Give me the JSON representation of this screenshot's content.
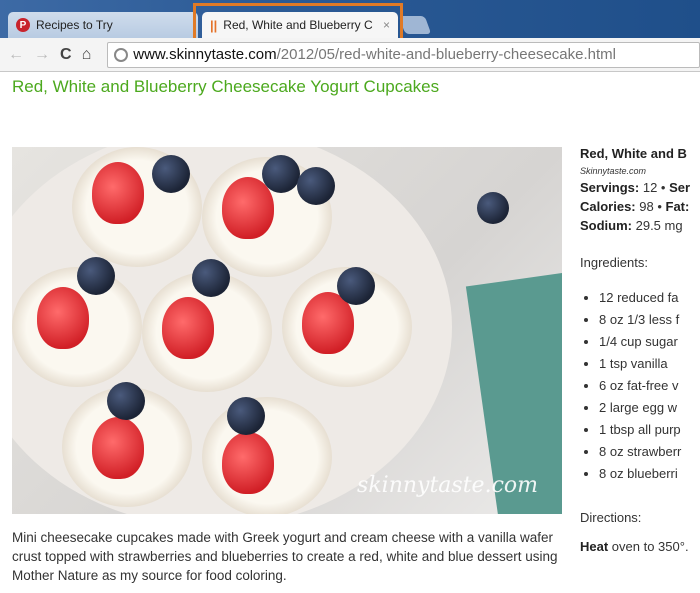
{
  "browser": {
    "tabs": [
      {
        "label": "Recipes to Try",
        "icon": "pinterest-icon",
        "active": false
      },
      {
        "label": "Red, White and Blueberry C",
        "icon": "fork-knife-icon",
        "active": true
      }
    ],
    "highlight_color": "#e07a26",
    "url_domain": "www.skinnytaste.com",
    "url_path": "/2012/05/red-white-and-blueberry-cheesecake.html"
  },
  "page": {
    "title": "Red, White and Blueberry Cheesecake Yogurt Cupcakes",
    "title_color": "#4ca91e",
    "watermark": "skinnytaste.com",
    "description": "Mini cheesecake cupcakes made with Greek yogurt and cream cheese with a vanilla wafer crust topped with strawberries and blueberries to create a red, white and blue dessert using Mother Nature as my source for food coloring."
  },
  "recipe": {
    "title": "Red, White and B",
    "source": "Skinnytaste.com",
    "servings_label": "Servings:",
    "servings_value": " 12 • ",
    "serving_size_label": "Ser",
    "calories_label": "Calories:",
    "calories_value": " 98 • ",
    "fat_label": "Fat:",
    "sodium_label": "Sodium:",
    "sodium_value": " 29.5 mg",
    "ingredients_heading": "Ingredients:",
    "ingredients": [
      "12 reduced fa",
      "8 oz 1/3 less f",
      "1/4 cup sugar",
      "1 tsp vanilla",
      "6 oz fat-free v",
      "2 large egg w",
      "1 tbsp all purp",
      "8 oz strawberr",
      "8 oz blueberri"
    ],
    "directions_heading": "Directions:",
    "direction_bold": "Heat",
    "direction_text": " oven to 350°."
  }
}
